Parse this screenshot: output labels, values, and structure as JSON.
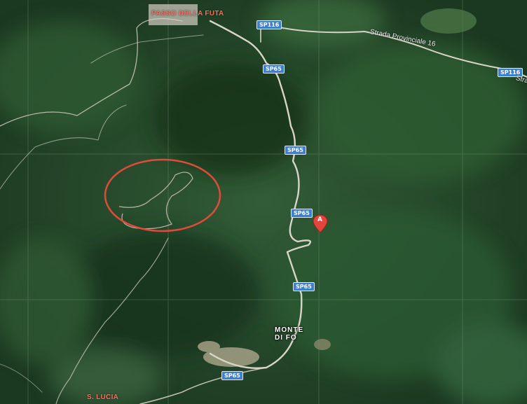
{
  "places": {
    "top": "PASSO DELLA FUTA",
    "bottom_left": "S. LUCIA",
    "town_line1": "MONTE",
    "town_line2": "DI FO"
  },
  "road_shields": [
    "SP116",
    "SP65",
    "SP65",
    "SP65",
    "SP65",
    "SP65",
    "SP116"
  ],
  "road_name": "Strada Provinciale 16",
  "road_name_tail": "Stra",
  "marker": {
    "label": "A",
    "color": "#e0463b"
  },
  "highlight": {
    "shape": "ellipse",
    "color": "#e24b3b"
  },
  "colors": {
    "forest_dark": "#1c3a21",
    "forest": "#2c5530",
    "road": "#d9d4c7",
    "shield": "#3f7fcf",
    "label": "#ff6a5c"
  }
}
